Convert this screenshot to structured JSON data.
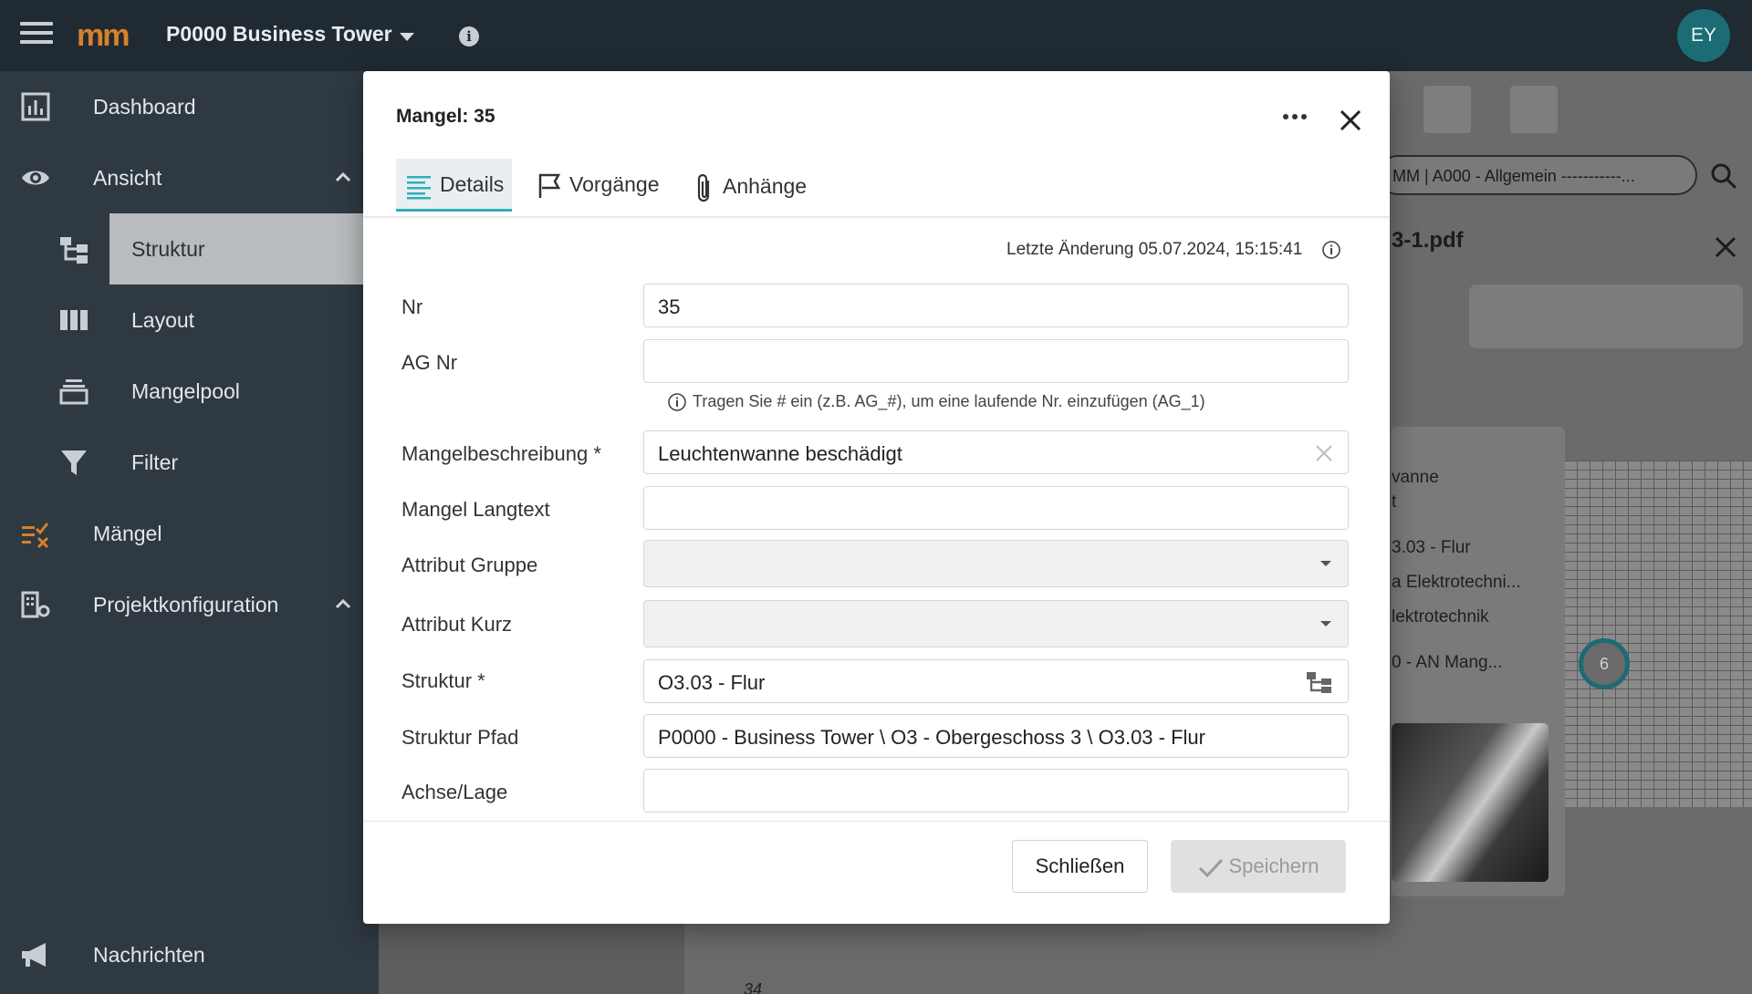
{
  "topbar": {
    "logo": "mm",
    "project": "P0000 Business Tower",
    "avatar": "EY"
  },
  "sidebar": {
    "items": [
      {
        "label": "Dashboard",
        "icon": "chart-icon"
      },
      {
        "label": "Ansicht",
        "icon": "eye-icon",
        "expanded": true
      },
      {
        "label": "Struktur",
        "icon": "structure-icon",
        "active": true
      },
      {
        "label": "Layout",
        "icon": "columns-icon"
      },
      {
        "label": "Mangelpool",
        "icon": "stack-icon"
      },
      {
        "label": "Filter",
        "icon": "filter-icon"
      },
      {
        "label": "Mängel",
        "icon": "defects-icon"
      },
      {
        "label": "Projektkonfiguration",
        "icon": "building-gear-icon",
        "expanded": true
      },
      {
        "label": "Nachrichten",
        "icon": "megaphone-icon"
      }
    ]
  },
  "background": {
    "search_value": "MM | A000 - Allgemein -----------...",
    "pdf_title": "3-1.pdf",
    "card_lines": [
      "vanne",
      "t",
      "3.03 - Flur",
      "a Elektrotechni...",
      "lektrotechnik",
      "0 - AN Mang..."
    ],
    "plan_marker": "6",
    "list_number": "34"
  },
  "dialog": {
    "title": "Mangel: 35",
    "tabs": [
      {
        "label": "Details",
        "icon": "lines-icon",
        "active": true
      },
      {
        "label": "Vorgänge",
        "icon": "flag-icon"
      },
      {
        "label": "Anhänge",
        "icon": "paperclip-icon"
      }
    ],
    "last_change": "Letzte Änderung 05.07.2024, 15:15:41",
    "fields": {
      "nr": {
        "label": "Nr",
        "value": "35"
      },
      "ag_nr": {
        "label": "AG Nr",
        "value": ""
      },
      "ag_hint": "Tragen Sie # ein (z.B. AG_#), um eine laufende Nr. einzufügen (AG_1)",
      "beschreibung": {
        "label": "Mangelbeschreibung *",
        "value": "Leuchtenwanne beschädigt"
      },
      "langtext": {
        "label": "Mangel Langtext",
        "value": ""
      },
      "attr_gruppe": {
        "label": "Attribut Gruppe",
        "value": ""
      },
      "attr_kurz": {
        "label": "Attribut Kurz",
        "value": ""
      },
      "struktur": {
        "label": "Struktur *",
        "value": "O3.03 - Flur"
      },
      "struktur_pfad": {
        "label": "Struktur Pfad",
        "value": "P0000 - Business Tower \\ O3 - Obergeschoss 3 \\ O3.03 - Flur"
      },
      "achse": {
        "label": "Achse/Lage",
        "value": ""
      }
    },
    "buttons": {
      "close": "Schließen",
      "save": "Speichern"
    }
  }
}
